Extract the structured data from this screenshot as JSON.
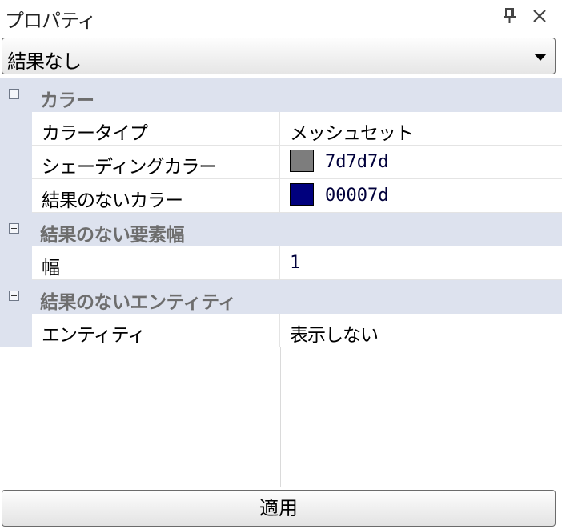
{
  "panel": {
    "title": "プロパティ",
    "pin_icon": "pin-icon",
    "close_icon": "close-icon"
  },
  "selector": {
    "value": "結果なし"
  },
  "categories": [
    {
      "label": "カラー",
      "properties": [
        {
          "name": "カラータイプ",
          "value": "メッシュセット"
        },
        {
          "name": "シェーディングカラー",
          "value": "7d7d7d",
          "swatch": "#7d7d7d"
        },
        {
          "name": "結果のないカラー",
          "value": "00007d",
          "swatch": "#00007d"
        }
      ]
    },
    {
      "label": "結果のない要素幅",
      "properties": [
        {
          "name": "幅",
          "value": "1"
        }
      ]
    },
    {
      "label": "結果のないエンティティ",
      "properties": [
        {
          "name": "エンティティ",
          "value": "表示しない"
        }
      ]
    }
  ],
  "apply_button": {
    "label": "適用"
  },
  "colors": {
    "category_bg": "#dde2ee",
    "category_text": "#6d6d6d",
    "gridline": "#e4e4e4"
  }
}
